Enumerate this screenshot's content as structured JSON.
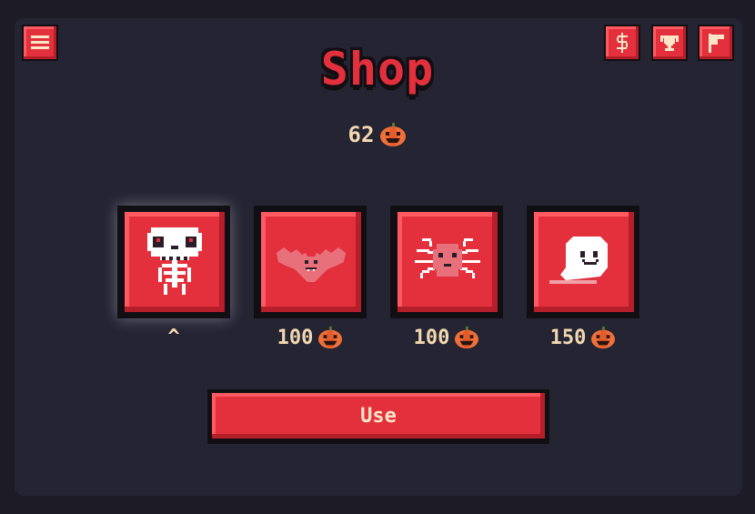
{
  "header": {
    "title": "Shop",
    "icons": [
      "menu-icon",
      "dollar-icon",
      "trophy-icon",
      "flag-icon"
    ]
  },
  "balance": {
    "amount": "62",
    "currency_icon": "pumpkin-icon"
  },
  "items": [
    {
      "name": "skeleton",
      "price": "",
      "selected_mark": "^",
      "selected": true
    },
    {
      "name": "bat",
      "price": "100"
    },
    {
      "name": "spider",
      "price": "100"
    },
    {
      "name": "ghost",
      "price": "150"
    }
  ],
  "actions": {
    "use_label": "Use"
  },
  "colors": {
    "background": "#1c1b26",
    "panel": "#252433",
    "accent_red": "#e3303c",
    "text_cream": "#f2d8b0",
    "pumpkin": "#f0703a"
  }
}
